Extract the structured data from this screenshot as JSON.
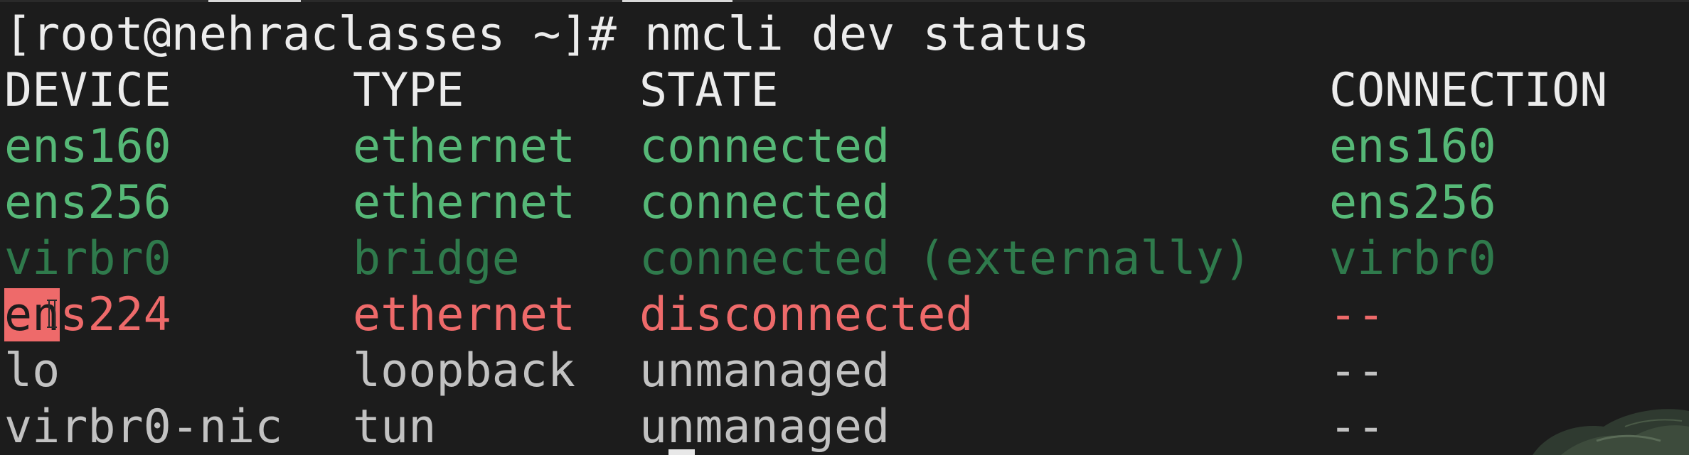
{
  "terminal": {
    "prompt": "[root@nehraclasses ~]# nmcli dev status",
    "headers": {
      "device": "DEVICE",
      "type": "TYPE",
      "state": "STATE",
      "connection": "CONNECTION"
    },
    "rows": [
      {
        "device": "ens160",
        "type": "ethernet",
        "state": "connected",
        "connection": "ens160"
      },
      {
        "device": "ens256",
        "type": "ethernet",
        "state": "connected",
        "connection": "ens256"
      },
      {
        "device": "virbr0",
        "type": "bridge",
        "state": "connected (externally)",
        "connection": "virbr0"
      },
      {
        "device_selected": "en",
        "device_rest": "s224",
        "type": "ethernet",
        "state": "disconnected",
        "connection": "--"
      },
      {
        "device": "lo",
        "type": "loopback",
        "state": "unmanaged",
        "connection": "--"
      },
      {
        "device": "virbr0-nic",
        "type": "tun",
        "state": "unmanaged",
        "connection": "--"
      }
    ]
  },
  "colors": {
    "background": "#1c1c1c",
    "connected": "#56b877",
    "connected_externally": "#2f7a4c",
    "disconnected": "#ee6a6a",
    "unmanaged": "#c2c2c2",
    "header": "#ececec"
  },
  "icons": {
    "mouse_cursor": "i-beam-cursor-icon",
    "corner_decoration": "plant-leaf-icon"
  }
}
